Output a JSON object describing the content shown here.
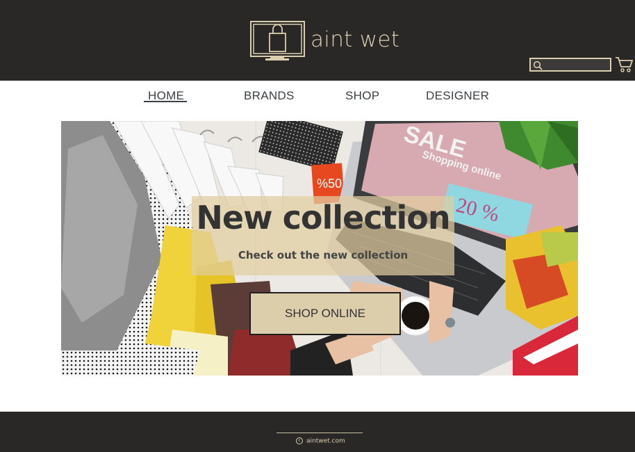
{
  "header": {
    "brand": "aint wet",
    "search": {
      "value": "",
      "placeholder": ""
    },
    "icons": {
      "logo": "shopping-bag-monitor-icon",
      "search": "magnifier-icon",
      "cart": "shopping-cart-icon"
    }
  },
  "nav": {
    "items": [
      {
        "label": "HOME",
        "active": true
      },
      {
        "label": "BRANDS",
        "active": false
      },
      {
        "label": "SHOP",
        "active": false
      },
      {
        "label": "DESIGNER",
        "active": false
      }
    ]
  },
  "hero": {
    "title": "New collection",
    "subtitle": "Check out the new collection",
    "button": "SHOP ONLINE",
    "image_text": {
      "sale": "SALE",
      "shopping": "Shopping online",
      "discount": "20 %",
      "tag": "%50"
    }
  },
  "footer": {
    "copyright": "aintwet.com"
  },
  "colors": {
    "header_bg": "#2a2827",
    "accent": "#dccfb0",
    "button_bg": "#dccdab",
    "nav_text": "#3a3f44"
  }
}
